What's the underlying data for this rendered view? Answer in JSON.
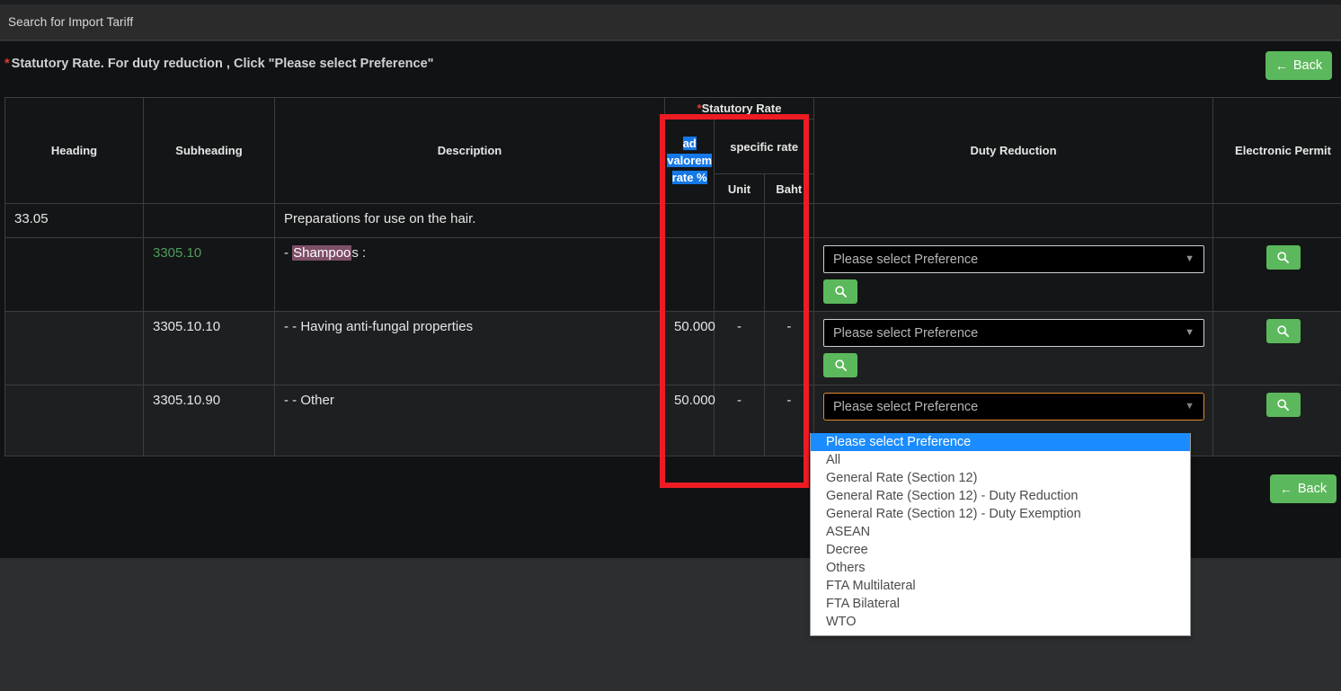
{
  "window": {
    "title": "Search for Import Tariff"
  },
  "notice": {
    "star": "*",
    "text": "Statutory Rate. For duty reduction , Click \"Please select Preference\""
  },
  "buttons": {
    "back_label": "Back",
    "back_arrow": "←",
    "search_icon": "search-icon"
  },
  "table": {
    "headers": {
      "heading": "Heading",
      "subheading": "Subheading",
      "description": "Description",
      "statutory_rate": "Statutory Rate",
      "statutory_rate_star": "*",
      "ad_valorem_rate": "ad valorem rate %",
      "specific_rate": "specific rate",
      "unit": "Unit",
      "baht": "Baht",
      "duty_reduction": "Duty Reduction",
      "electronic_permit": "Electronic Permit"
    },
    "rows": [
      {
        "heading": "33.05",
        "subheading": "",
        "description": "Preparations for use on the hair.",
        "description_prefix": "",
        "ad_valorem": "",
        "unit": "",
        "baht": "",
        "has_select": false,
        "has_permit_button": false,
        "select_value": "",
        "highlight": ""
      },
      {
        "heading": "",
        "subheading": "3305.10",
        "description_prefix": "-",
        "highlight": "Shampoo",
        "description_suffix": "s :",
        "description": "-  Shampoos :",
        "ad_valorem": "",
        "unit": "",
        "baht": "",
        "has_select": true,
        "has_permit_button": true,
        "select_value": "Please select Preference",
        "select_focused": false
      },
      {
        "heading": "",
        "subheading": "3305.10.10",
        "description_prefix": "- -",
        "highlight": "",
        "description_suffix": "",
        "description": "- - Having anti-fungal properties",
        "ad_valorem": "50.000",
        "unit": "-",
        "baht": "-",
        "has_select": true,
        "has_permit_button": true,
        "select_value": "Please select Preference",
        "select_focused": false
      },
      {
        "heading": "",
        "subheading": "3305.10.90",
        "description_prefix": "- -",
        "highlight": "",
        "description_suffix": "",
        "description": "- - Other",
        "ad_valorem": "50.000",
        "unit": "-",
        "baht": "-",
        "has_select": true,
        "has_permit_button": false,
        "select_value": "Please select Preference",
        "select_focused": true
      }
    ]
  },
  "dropdown": {
    "open": true,
    "selected_index": 0,
    "options": [
      "Please select Preference",
      "All",
      "General Rate (Section 12)",
      "General Rate (Section 12) - Duty Reduction",
      "General Rate (Section 12) - Duty Exemption",
      "ASEAN",
      "Decree",
      "Others",
      "FTA Multilateral",
      "FTA Bilateral",
      "WTO"
    ]
  },
  "annotation": {
    "red_box": "highlight-rectangle-around-statutory-rate-column",
    "red_box_color": "#ed1c24"
  },
  "colors": {
    "accent_green": "#5cb85c",
    "highlight_blue": "#1478e8",
    "dropdown_selected": "#1a8cff",
    "search_highlight_pink": "#7e4f68",
    "subheading_green": "#4d9d5c",
    "notice_star_red": "#e13b2e",
    "focus_orange": "#e08a2e"
  }
}
